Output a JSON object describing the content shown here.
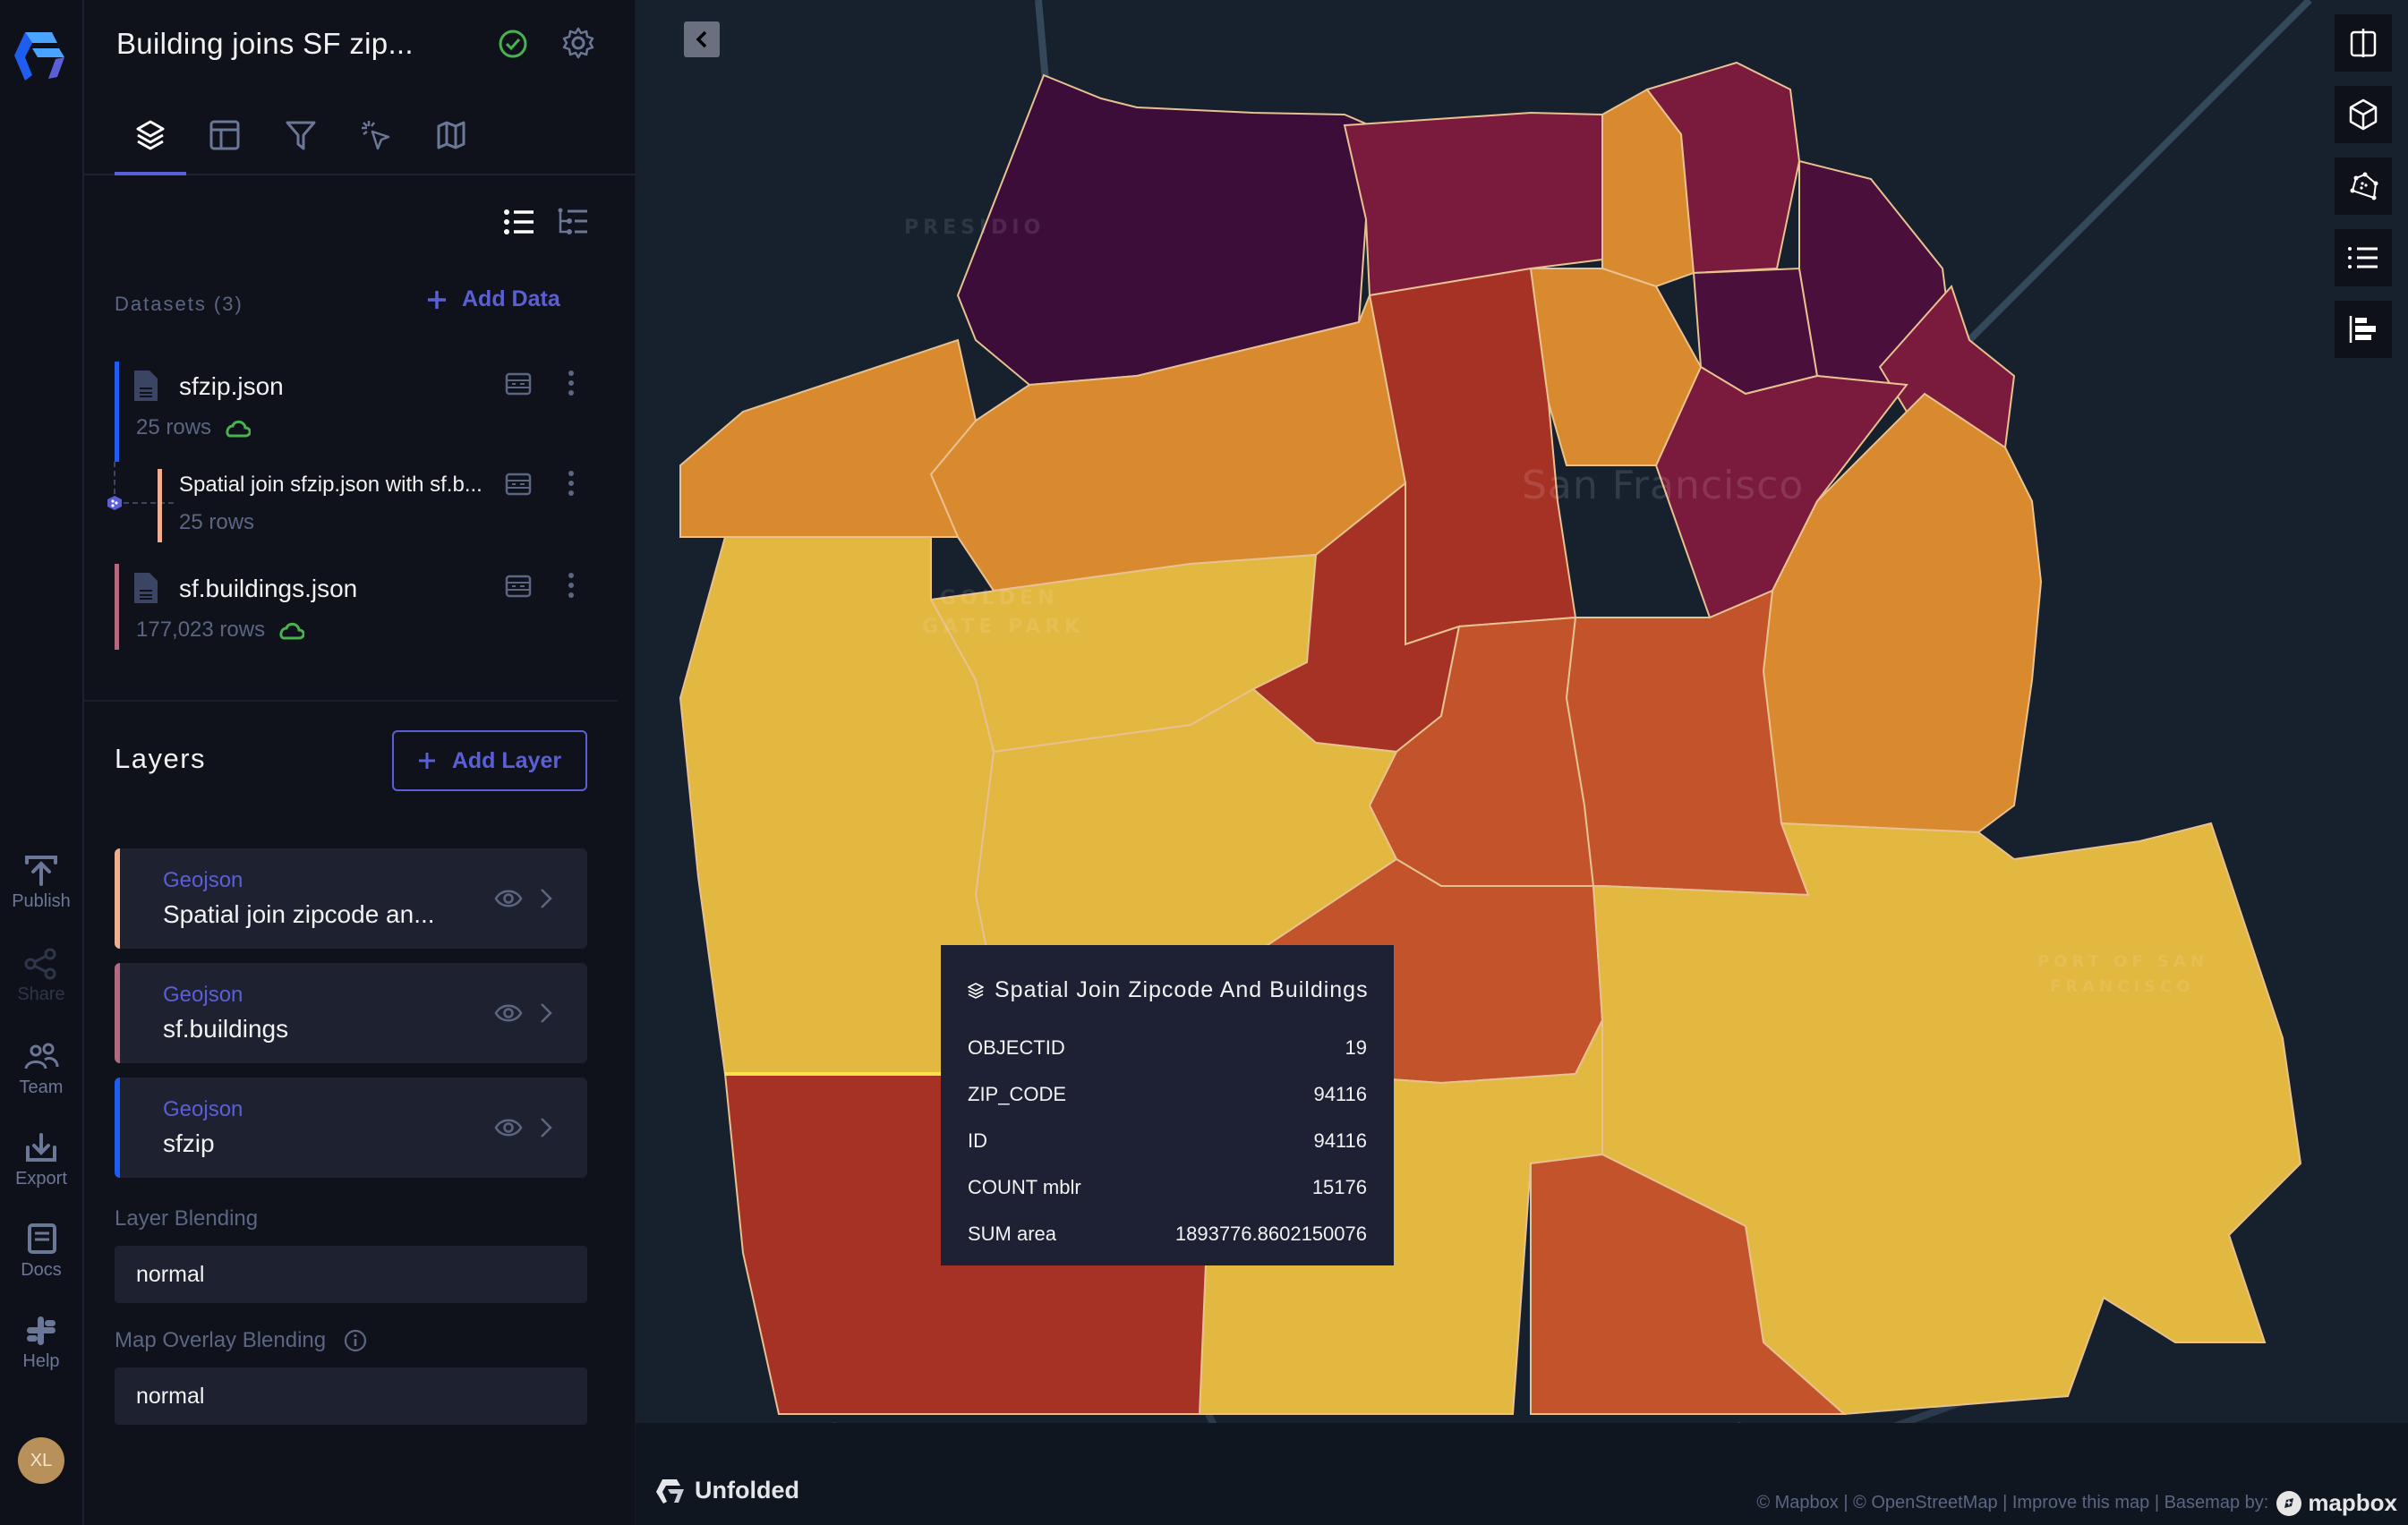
{
  "app": {
    "title": "Building joins SF zip...",
    "status_icon": "check-circle-icon",
    "settings_icon": "gear-icon"
  },
  "rail": {
    "items": [
      {
        "label": "Publish",
        "icon": "publish-icon",
        "enabled": true
      },
      {
        "label": "Share",
        "icon": "share-icon",
        "enabled": false
      },
      {
        "label": "Team",
        "icon": "team-icon",
        "enabled": true
      },
      {
        "label": "Export",
        "icon": "export-icon",
        "enabled": true
      },
      {
        "label": "Docs",
        "icon": "docs-icon",
        "enabled": true
      },
      {
        "label": "Help",
        "icon": "slack-icon",
        "enabled": true
      }
    ],
    "avatar_initials": "XL"
  },
  "tabs": [
    {
      "name": "layers",
      "icon": "layers-icon",
      "active": true
    },
    {
      "name": "layout",
      "icon": "layout-icon",
      "active": false
    },
    {
      "name": "filters",
      "icon": "filter-icon",
      "active": false
    },
    {
      "name": "interactions",
      "icon": "interaction-icon",
      "active": false
    },
    {
      "name": "basemap",
      "icon": "map-icon",
      "active": false
    }
  ],
  "datasets": {
    "label": "Datasets (3)",
    "add_label": "Add Data",
    "items": [
      {
        "name": "sfzip.json",
        "rows": "25 rows",
        "color": "#1f5cf0",
        "synced": true
      },
      {
        "name": "Spatial join sfzip.json with sf.b...",
        "rows": "25 rows",
        "color": "#f0b090",
        "synced": false,
        "derived": true
      },
      {
        "name": "sf.buildings.json",
        "rows": "177,023 rows",
        "color": "#b36a7e",
        "synced": true
      }
    ]
  },
  "layers": {
    "title": "Layers",
    "add_label": "Add Layer",
    "items": [
      {
        "type": "Geojson",
        "name": "Spatial join zipcode an...",
        "color": "#f0b090",
        "visible": true
      },
      {
        "type": "Geojson",
        "name": "sf.buildings",
        "color": "#b36a7e",
        "visible": true
      },
      {
        "type": "Geojson",
        "name": "sfzip",
        "color": "#1f5cf0",
        "visible": true
      }
    ]
  },
  "blending": {
    "layer_label": "Layer Blending",
    "layer_value": "normal",
    "overlay_label": "Map Overlay Blending",
    "overlay_value": "normal"
  },
  "map": {
    "labels": {
      "presidio": "PRESIDIO",
      "golden_gate_1": "GOLDEN",
      "golden_gate_2": "GATE PARK",
      "san_francisco": "San Francisco",
      "port_1": "PORT OF SAN",
      "port_2": "FRANCISCO"
    },
    "controls": [
      "split-map-icon",
      "3d-cube-icon",
      "draw-polygon-icon",
      "legend-icon",
      "layer-order-icon"
    ],
    "palette": {
      "c1": "#3d0d3a",
      "c2": "#7a1a3c",
      "c3": "#a63226",
      "c4": "#c2532a",
      "c5": "#d98a2e",
      "c6": "#e3b840",
      "outline": "#e8c190"
    }
  },
  "tooltip": {
    "title": "Spatial Join Zipcode And Buildings",
    "rows": [
      {
        "key": "OBJECTID",
        "value": "19"
      },
      {
        "key": "ZIP_CODE",
        "value": "94116"
      },
      {
        "key": "ID",
        "value": "94116"
      },
      {
        "key": "COUNT mblr",
        "value": "15176"
      },
      {
        "key": "SUM area",
        "value": "1893776.8602150076"
      }
    ]
  },
  "footer": {
    "brand": "Unfolded",
    "attribution": "© Mapbox | © OpenStreetMap | Improve this map | Basemap by:",
    "mapbox": "mapbox"
  }
}
